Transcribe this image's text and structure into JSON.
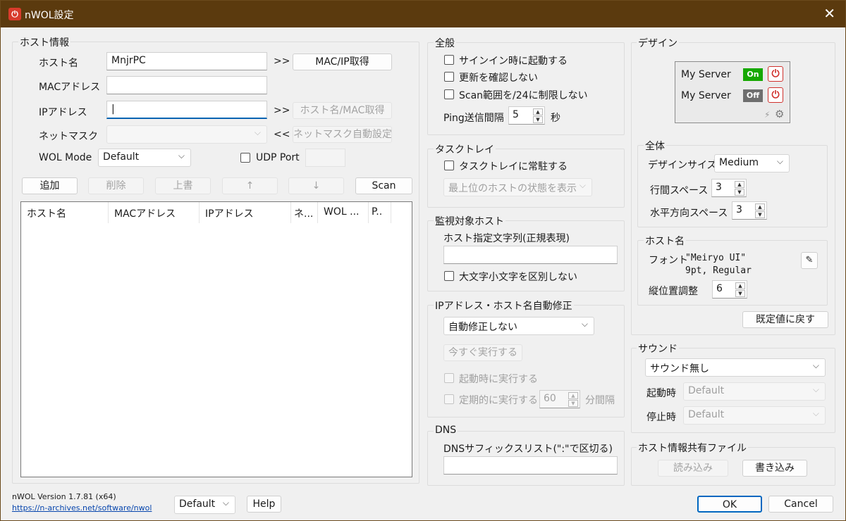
{
  "window": {
    "title": "nWOL設定",
    "close_glyph": "✕"
  },
  "host_info": {
    "group_title": "ホスト情報",
    "hostname_label": "ホスト名",
    "hostname_value": "MnjrPC",
    "arrow_right": ">>",
    "mac_ip_button": "MAC/IP取得",
    "mac_label": "MACアドレス",
    "mac_value": "",
    "ip_label": "IPアドレス",
    "ip_value": "|",
    "host_mac_button": "ホスト名/MAC取得",
    "netmask_label": "ネットマスク",
    "netmask_value": "",
    "arrow_left": "<<",
    "netmask_button": "ネットマスク自動設定",
    "wol_mode_label": "WOL Mode",
    "wol_mode_value": "Default",
    "udp_port_label": "UDP Port",
    "udp_port_value": ""
  },
  "list_toolbar": {
    "add": "追加",
    "delete": "削除",
    "overwrite": "上書",
    "up": "↑",
    "down": "↓",
    "scan": "Scan"
  },
  "host_list": {
    "columns": [
      "ホスト名",
      "MACアドレス",
      "IPアドレス",
      "ネ...",
      "WOL ...",
      "P.."
    ]
  },
  "general": {
    "group_title": "全般",
    "start_on_signin": "サインイン時に起動する",
    "no_update_check": "更新を確認しない",
    "scan_limit": "Scan範囲を/24に制限しない",
    "ping_label": "Ping送信間隔",
    "ping_value": "5",
    "ping_unit": "秒"
  },
  "tasktray": {
    "group_title": "タスクトレイ",
    "resident": "タスクトレイに常駐する",
    "display_option": "最上位のホストの状態を表示"
  },
  "monitor": {
    "group_title": "監視対象ホスト",
    "regex_label": "ホスト指定文字列(正規表現)",
    "regex_value": "",
    "ignore_case": "大文字小文字を区別しない"
  },
  "auto_fix": {
    "group_title": "IPアドレス・ホスト名自動修正",
    "mode_value": "自動修正しない",
    "run_now": "今すぐ実行する",
    "run_on_start": "起動時に実行する",
    "run_periodic": "定期的に実行する",
    "interval_value": "60",
    "interval_unit": "分間隔"
  },
  "dns": {
    "group_title": "DNS",
    "suffix_label": "DNSサフィックスリスト(\":\"で区切る)",
    "suffix_value": ""
  },
  "design": {
    "group_title": "デザイン",
    "preview": {
      "server1": "My Server",
      "state1": "On",
      "state1_color": "#16a800",
      "server2": "My Server",
      "state2": "Off",
      "state2_color": "#6e6e6e",
      "power_glyph": "⏻",
      "bolt_glyph": "⚡",
      "gear_glyph": "⚙"
    }
  },
  "overall": {
    "group_title": "全体",
    "size_label": "デザインサイズ",
    "size_value": "Medium",
    "row_space_label": "行間スペース",
    "row_space_value": "3",
    "h_space_label": "水平方向スペース",
    "h_space_value": "3"
  },
  "hostname_font": {
    "group_title": "ホスト名",
    "font_label": "フォント",
    "font_name": "\"Meiryo UI\"",
    "font_detail": "9pt, Regular",
    "vpos_label": "縦位置調整",
    "vpos_value": "6",
    "edit_glyph": "✎"
  },
  "reset_button": "既定値に戻す",
  "sound": {
    "group_title": "サウンド",
    "value": "サウンド無し",
    "start_label": "起動時",
    "start_value": "Default",
    "stop_label": "停止時",
    "stop_value": "Default"
  },
  "share_file": {
    "group_title": "ホスト情報共有ファイル",
    "read": "読み込み",
    "write": "書き込み"
  },
  "footer": {
    "version": "nWOL Version 1.7.81 (x64)",
    "url": "https://n-archives.net/software/nwol",
    "profile_value": "Default",
    "help": "Help",
    "ok": "OK",
    "cancel": "Cancel"
  },
  "chevron": "⌵"
}
